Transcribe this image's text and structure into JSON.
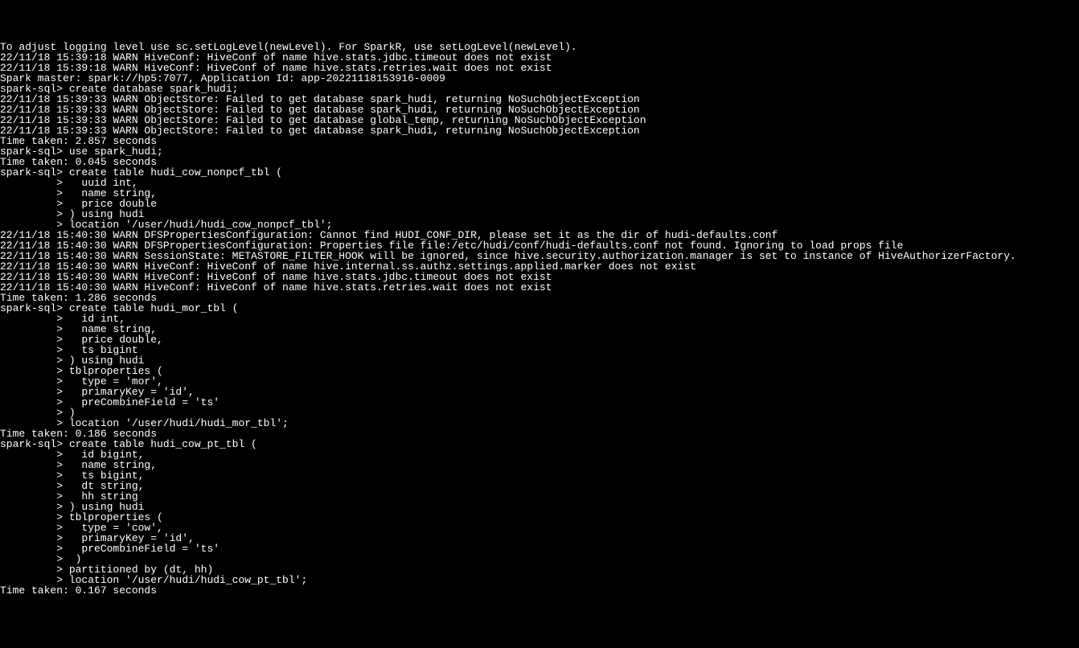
{
  "lines": [
    "To adjust logging level use sc.setLogLevel(newLevel). For SparkR, use setLogLevel(newLevel).",
    "22/11/18 15:39:18 WARN HiveConf: HiveConf of name hive.stats.jdbc.timeout does not exist",
    "22/11/18 15:39:18 WARN HiveConf: HiveConf of name hive.stats.retries.wait does not exist",
    "Spark master: spark://hp5:7077, Application Id: app-20221118153916-0009",
    "spark-sql> create database spark_hudi;",
    "22/11/18 15:39:33 WARN ObjectStore: Failed to get database spark_hudi, returning NoSuchObjectException",
    "22/11/18 15:39:33 WARN ObjectStore: Failed to get database spark_hudi, returning NoSuchObjectException",
    "22/11/18 15:39:33 WARN ObjectStore: Failed to get database global_temp, returning NoSuchObjectException",
    "22/11/18 15:39:33 WARN ObjectStore: Failed to get database spark_hudi, returning NoSuchObjectException",
    "Time taken: 2.857 seconds",
    "spark-sql> use spark_hudi;",
    "Time taken: 0.045 seconds",
    "spark-sql> create table hudi_cow_nonpcf_tbl (",
    "         >   uuid int,",
    "         >   name string,",
    "         >   price double",
    "         > ) using hudi",
    "         > location '/user/hudi/hudi_cow_nonpcf_tbl';",
    "22/11/18 15:40:30 WARN DFSPropertiesConfiguration: Cannot find HUDI_CONF_DIR, please set it as the dir of hudi-defaults.conf",
    "22/11/18 15:40:30 WARN DFSPropertiesConfiguration: Properties file file:/etc/hudi/conf/hudi-defaults.conf not found. Ignoring to load props file",
    "22/11/18 15:40:30 WARN SessionState: METASTORE_FILTER_HOOK will be ignored, since hive.security.authorization.manager is set to instance of HiveAuthorizerFactory.",
    "22/11/18 15:40:30 WARN HiveConf: HiveConf of name hive.internal.ss.authz.settings.applied.marker does not exist",
    "22/11/18 15:40:30 WARN HiveConf: HiveConf of name hive.stats.jdbc.timeout does not exist",
    "22/11/18 15:40:30 WARN HiveConf: HiveConf of name hive.stats.retries.wait does not exist",
    "Time taken: 1.286 seconds",
    "spark-sql> create table hudi_mor_tbl (",
    "         >   id int,",
    "         >   name string,",
    "         >   price double,",
    "         >   ts bigint",
    "         > ) using hudi",
    "         > tblproperties (",
    "         >   type = 'mor',",
    "         >   primaryKey = 'id',",
    "         >   preCombineField = 'ts'",
    "         > )",
    "         > location '/user/hudi/hudi_mor_tbl';",
    "Time taken: 0.186 seconds",
    "spark-sql> create table hudi_cow_pt_tbl (",
    "         >   id bigint,",
    "         >   name string,",
    "         >   ts bigint,",
    "         >   dt string,",
    "         >   hh string",
    "         > ) using hudi",
    "         > tblproperties (",
    "         >   type = 'cow',",
    "         >   primaryKey = 'id',",
    "         >   preCombineField = 'ts'",
    "         >  )",
    "         > partitioned by (dt, hh)",
    "         > location '/user/hudi/hudi_cow_pt_tbl';",
    "Time taken: 0.167 seconds"
  ]
}
